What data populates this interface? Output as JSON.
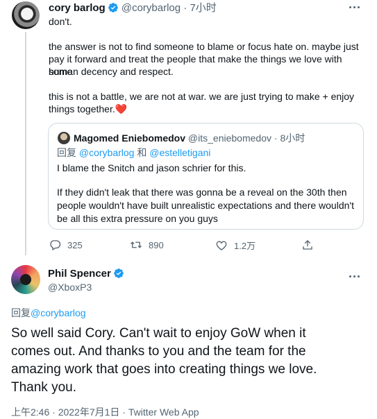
{
  "tweet1": {
    "name": "cory barlog",
    "handle": "@corybarlog",
    "separator": "·",
    "time": "7小时",
    "lines": [
      "don't.",
      "the answer is not to find someone to blame or focus hate on. maybe just",
      "pay it forward and treat the people that make the things we love with some",
      "human decency and respect.",
      "this is not a battle, we are not at war. we are just trying to make + enjoy",
      "things together."
    ],
    "emoji": "❤️",
    "quote": {
      "name": "Magomed Eniebomedov",
      "handle": "@its_eniebomedov",
      "separator": "·",
      "time": "8小时",
      "reply_prefix": "回复",
      "reply_user1": "@corybarlog",
      "reply_and": "和",
      "reply_user2": "@estelletigani",
      "lines": [
        "I blame the Snitch and jason schrier for this.",
        "If they didn't leak that there was gonna be a reveal on the 30th then",
        "people wouldn't have built unrealistic expectations and there wouldn't",
        "be all this extra pressure on you guys"
      ]
    },
    "actions": {
      "replies": "325",
      "retweets": "890",
      "likes": "1.2万"
    }
  },
  "tweet2": {
    "name": "Phil Spencer",
    "handle": "@XboxP3",
    "reply_prefix": "回复",
    "reply_user": "@corybarlog",
    "lines": [
      "So well said Cory. Can't wait to enjoy GoW when it",
      "comes out. And thanks to you and the team for the",
      "amazing work that goes into creating things we love.",
      "Thank you."
    ],
    "meta": "上午2:46 · 2022年7月1日 · Twitter Web App"
  },
  "icons": {
    "verified": "verified-badge-icon",
    "more": "more-icon",
    "reply": "reply-icon",
    "retweet": "retweet-icon",
    "like": "heart-icon",
    "share": "share-icon"
  },
  "colors": {
    "accent": "#1d9bf0",
    "text": "#0f1419",
    "muted": "#536471",
    "border": "#cfd9de",
    "heart": "#e0245e"
  }
}
